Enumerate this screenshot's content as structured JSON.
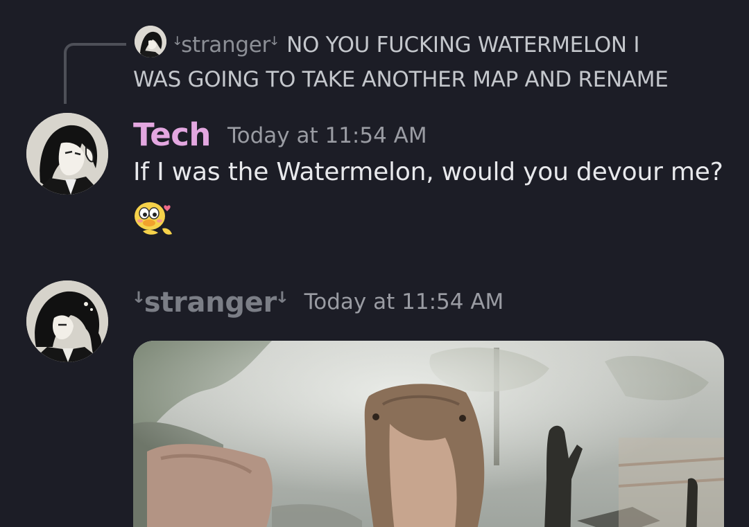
{
  "reply": {
    "author": "ꜜstrangerꜜ",
    "text_line1": "NO YOU FUCKING WATERMELON I",
    "text_line2": "WAS GOING TO TAKE ANOTHER MAP AND RENAME"
  },
  "messages": [
    {
      "author": "Tech",
      "timestamp": "Today at 11:54 AM",
      "text": "If I was the Watermelon, would you devour me?",
      "emoji": "blushing-duck-emoji"
    },
    {
      "author": "ꜜstrangerꜜ",
      "timestamp": "Today at 11:54 AM",
      "attachment": "capybara-gif"
    }
  ],
  "colors": {
    "background": "#1c1d26",
    "tech_name": "#e3a7e0",
    "stranger_name": "#7b7e86",
    "timestamp": "#9a9ca3",
    "body_text": "#e8e9ec"
  }
}
